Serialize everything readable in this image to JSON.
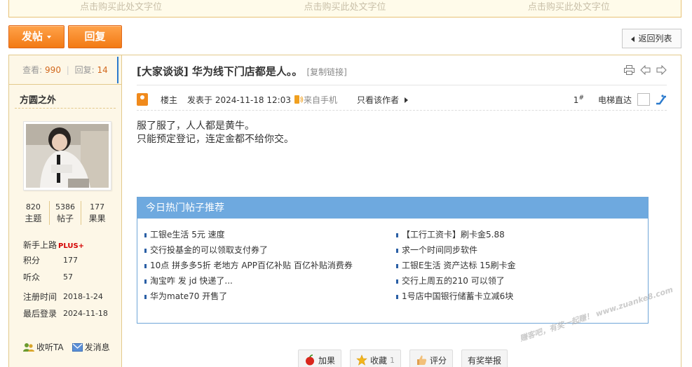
{
  "adbar": {
    "slots": [
      "点击购买此处文字位",
      "点击购买此处文字位",
      "点击购买此处文字位"
    ]
  },
  "toolbar": {
    "post_label": "发帖",
    "reply_label": "回复",
    "back_label": "返回列表"
  },
  "sidebar": {
    "views_label": "查看:",
    "views": "990",
    "replies_label": "回复:",
    "replies": "14",
    "username": "方圆之外",
    "counts": [
      {
        "value": "820",
        "label": "主题"
      },
      {
        "value": "5386",
        "label": "帖子"
      },
      {
        "value": "177",
        "label": "果果"
      }
    ],
    "rank": "新手上路",
    "rank_badge": "PLUS+",
    "points_label": "积分",
    "points": "177",
    "listeners_label": "听众",
    "listeners": "57",
    "register_label": "注册时间",
    "register_date": "2018-1-24",
    "last_login_label": "最后登录",
    "last_login": "2024-11-18",
    "follow_label": "收听TA",
    "message_label": "发消息"
  },
  "post": {
    "title": "[大家谈谈] 华为线下门店都是人。。",
    "copy_link": "[复制链接]",
    "host_label": "楼主",
    "posted": "发表于 2024-11-18 12:03",
    "from": "来自手机",
    "only_author": "只看该作者",
    "floor": "1",
    "floor_sup": "#",
    "jump_label": "电梯直达",
    "lines": [
      "服了服了，人人都是黄牛。",
      "只能预定登记，连定金都不给你交。"
    ]
  },
  "hot": {
    "title": "今日热门帖子推荐",
    "left": [
      "工银e生活 5元 速度",
      "交行投基金的可以领取支付券了",
      "10点 拼多多5折 老地方 APP百亿补贴 百亿补贴消费券",
      "淘宝咋 发 jd 快递了...",
      "华为mate70 开售了"
    ],
    "right": [
      "【工行工资卡】刷卡金5.88",
      "求一个时间同步软件",
      "工银E生活 资产达标 15刷卡金",
      "交行上周五的210 可以领了",
      "1号店中国银行储蓄卡立减6块"
    ]
  },
  "bottom": {
    "add_score": "加果",
    "favorite": "收藏",
    "favorite_count": "1",
    "rate": "评分",
    "report": "有奖举报"
  },
  "watermark": "赚客吧，有奖一起赚！ www.zuanke8.com",
  "colors": {
    "accent_orange": "#f27a14",
    "hot_header": "#6ea9df",
    "border_gold": "#e3c98c"
  }
}
